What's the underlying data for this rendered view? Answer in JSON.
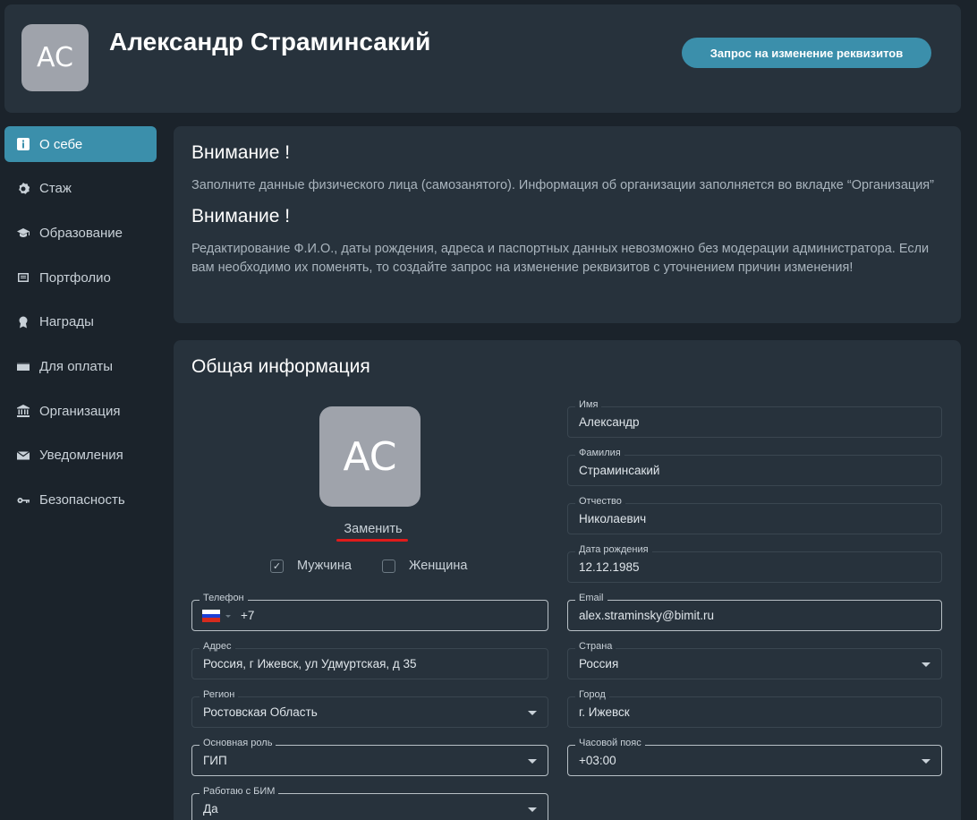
{
  "header": {
    "avatar_initials": "AC",
    "name": "Александр Страминсакий",
    "request_button": "Запрос на изменение реквизитов"
  },
  "sidebar": {
    "items": [
      {
        "label": "О себе",
        "icon": "info-icon",
        "active": true
      },
      {
        "label": "Стаж",
        "icon": "gear-icon"
      },
      {
        "label": "Образование",
        "icon": "graduation-cap-icon"
      },
      {
        "label": "Портфолио",
        "icon": "document-icon"
      },
      {
        "label": "Награды",
        "icon": "award-icon"
      },
      {
        "label": "Для оплаты",
        "icon": "wallet-icon"
      },
      {
        "label": "Организация",
        "icon": "bank-icon"
      },
      {
        "label": "Уведомления",
        "icon": "mail-icon"
      },
      {
        "label": "Безопасность",
        "icon": "key-icon"
      }
    ]
  },
  "warnings": [
    {
      "title": "Внимание !",
      "text": "Заполните данные физического лица (самозанятого). Информация об организации заполняется во вкладке “Организация”"
    },
    {
      "title": "Внимание !",
      "text": "Редактирование Ф.И.О., даты рождения, адреса и паспортных данных невозможно без модерации администратора. Если вам необходимо их поменять, то создайте запрос на изменение реквизитов с уточнением причин изменения!"
    }
  ],
  "general": {
    "title": "Общая информация",
    "avatar_initials": "AC",
    "replace_link": "Заменить",
    "gender_male": "Мужчина",
    "gender_female": "Женщина",
    "gender_male_checked": true,
    "gender_female_checked": false
  },
  "fields": {
    "first_name": {
      "label": "Имя",
      "value": "Александр"
    },
    "last_name": {
      "label": "Фамилия",
      "value": "Страминсакий"
    },
    "patronymic": {
      "label": "Отчество",
      "value": "Николаевич"
    },
    "birth_date": {
      "label": "Дата рождения",
      "value": "12.12.1985"
    },
    "phone": {
      "label": "Телефон",
      "value": "+7"
    },
    "email": {
      "label": "Email",
      "value": "alex.straminsky@bimit.ru"
    },
    "address": {
      "label": "Адрес",
      "value": "Россия, г Ижевск, ул Удмуртская, д 35"
    },
    "country": {
      "label": "Страна",
      "value": "Россия"
    },
    "region": {
      "label": "Регион",
      "value": "Ростовская Область"
    },
    "city": {
      "label": "Город",
      "value": "г. Ижевск"
    },
    "role": {
      "label": "Основная роль",
      "value": "ГИП"
    },
    "timezone": {
      "label": "Часовой пояс",
      "value": "+03:00"
    },
    "bim": {
      "label": "Работаю с БИМ",
      "value": "Да"
    }
  },
  "colors": {
    "accent": "#3b8fab",
    "background": "#1b232b",
    "card": "#27323c",
    "underline": "#e01b1b"
  }
}
